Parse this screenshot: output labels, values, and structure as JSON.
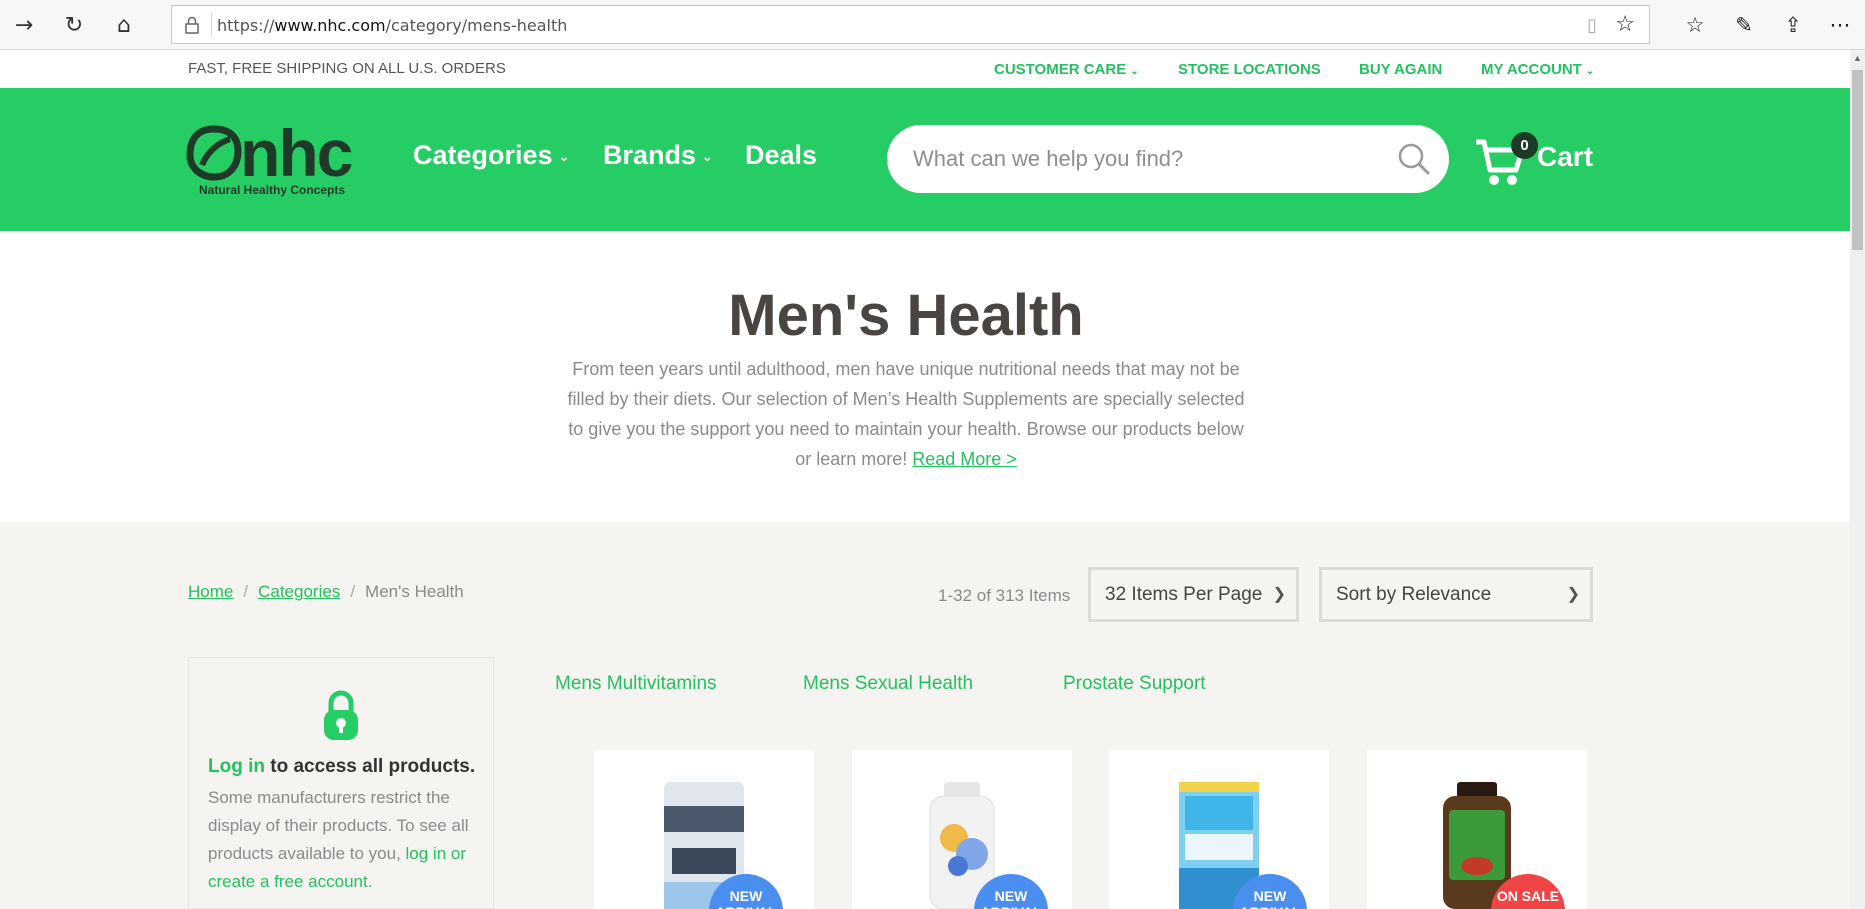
{
  "browser": {
    "url_prefix": "https://",
    "url_domain": "www.nhc.com",
    "url_path": "/category/mens-health",
    "icons": [
      "forward-icon",
      "refresh-icon",
      "home-icon",
      "lock-icon",
      "reading-view-icon",
      "favorite-star-icon",
      "favorites-icon",
      "pen-icon",
      "share-icon",
      "more-icon"
    ]
  },
  "utility": {
    "shipping": "FAST, FREE SHIPPING ON ALL U.S. ORDERS",
    "customer_care": "CUSTOMER CARE",
    "store_locations": "STORE LOCATIONS",
    "buy_again": "BUY AGAIN",
    "my_account": "MY ACCOUNT"
  },
  "header": {
    "logo": "nhc",
    "logo_sub": "Natural Healthy Concepts",
    "nav": {
      "categories": "Categories",
      "brands": "Brands",
      "deals": "Deals"
    },
    "search_placeholder": "What can we help you find?",
    "cart_count": "0",
    "cart_label": "Cart"
  },
  "hero": {
    "title": "Men's Health",
    "description": "From teen years until adulthood, men have unique nutritional needs that may not be filled by their diets. Our selection of Men’s Health Supplements are specially selected to give you the support you need to maintain your health. Browse our products below or learn more!",
    "read_more": "Read More >"
  },
  "breadcrumb": {
    "home": "Home",
    "categories": "Categories",
    "current": "Men's Health",
    "separator": "/"
  },
  "listing": {
    "count": "1-32 of 313 Items",
    "per_page": "32 Items Per Page",
    "sort": "Sort by Relevance"
  },
  "login": {
    "link": "Log in",
    "title_rest": " to access all products.",
    "text": "Some manufacturers restrict the display of their products. To see all products available to you, ",
    "text_link": "log in or create a free account."
  },
  "subcategories": [
    "Mens Multivitamins",
    "Mens Sexual Health",
    "Prostate Support"
  ],
  "products": [
    {
      "badge": "NEW ARRIVAL",
      "badge_color": "#4a8ef0"
    },
    {
      "badge": "NEW ARRIVAL",
      "badge_color": "#4a8ef0"
    },
    {
      "badge": "NEW ARRIVAL",
      "badge_color": "#4a8ef0"
    },
    {
      "badge": "ON SALE",
      "badge_color": "#ef4545"
    }
  ],
  "colors": {
    "brand_green": "#26cc64",
    "link_green": "#25c05f",
    "dark_green": "#1d3a28"
  }
}
